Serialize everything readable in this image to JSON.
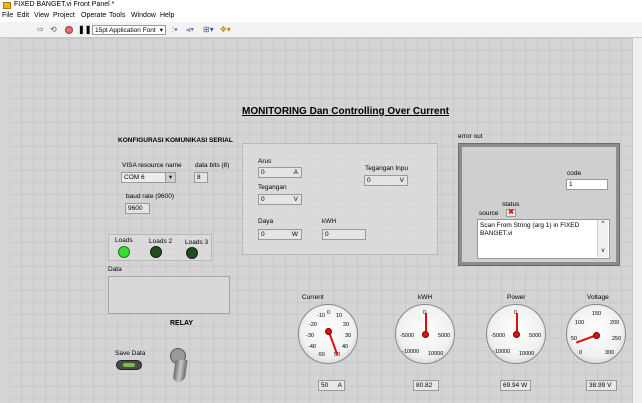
{
  "window": {
    "title": "FIXED BANGET.vi Front Panel *"
  },
  "menu": [
    "File",
    "Edit",
    "View",
    "Project",
    "Operate",
    "Tools",
    "Window",
    "Help"
  ],
  "toolbar": {
    "font": "15pt Application Font"
  },
  "panel": {
    "title": "MONITORING Dan Controlling Over Current",
    "serial": {
      "heading": "KONFIGURASI KOMUNIKASI SERIAL",
      "visa_label": "VISA resource name",
      "visa_value": "COM 6",
      "databits_label": "data bits (8)",
      "databits_value": "8",
      "baud_label": "baud rate (9600)",
      "baud_value": "9600"
    },
    "leds": [
      {
        "label": "Loads",
        "color": "#33dd33"
      },
      {
        "label": "Loads 2",
        "color": "#1e4d1e"
      },
      {
        "label": "Loads 3",
        "color": "#1e4d1e"
      }
    ],
    "data_label": "Data",
    "relay_label": "RELAY",
    "save_label": "Save Data",
    "readings": {
      "arus_label": "Arus",
      "arus_value": "0",
      "arus_unit": "A",
      "tegangan_label": "Tegangan",
      "tegangan_value": "0",
      "tegangan_unit": "V",
      "daya_label": "Daya",
      "daya_value": "0",
      "daya_unit": "W",
      "kwh_label": "kWH",
      "kwh_value": "0",
      "input_label": "Tegangan Inpu",
      "input_value": "0",
      "input_unit": "V"
    },
    "error": {
      "title": "error out",
      "code_label": "code",
      "code_value": "1",
      "status_label": "status",
      "source_label": "source",
      "source_text": "Scan From String (arg 1) in FIXED BANGET.vi"
    },
    "gauges": [
      {
        "name": "current",
        "label": "Current",
        "ticks": [
          "-10",
          "0",
          "10",
          "-20",
          "20",
          "-30",
          "30",
          "-40",
          "40",
          "-50",
          "50"
        ],
        "value": "50",
        "unit": "A"
      },
      {
        "name": "kwh",
        "label": "kWH",
        "ticks": [
          "0",
          "-5000",
          "5000",
          "-10000",
          "10000"
        ],
        "value": "80.82",
        "unit": ""
      },
      {
        "name": "power",
        "label": "Power",
        "ticks": [
          "0",
          "-5000",
          "5000",
          "-10000",
          "10000"
        ],
        "value": "69.94 W",
        "unit": ""
      },
      {
        "name": "voltage",
        "label": "Voltage",
        "ticks": [
          "150",
          "100",
          "200",
          "50",
          "250",
          "0",
          "300"
        ],
        "value": "38.99 V",
        "unit": ""
      }
    ]
  }
}
